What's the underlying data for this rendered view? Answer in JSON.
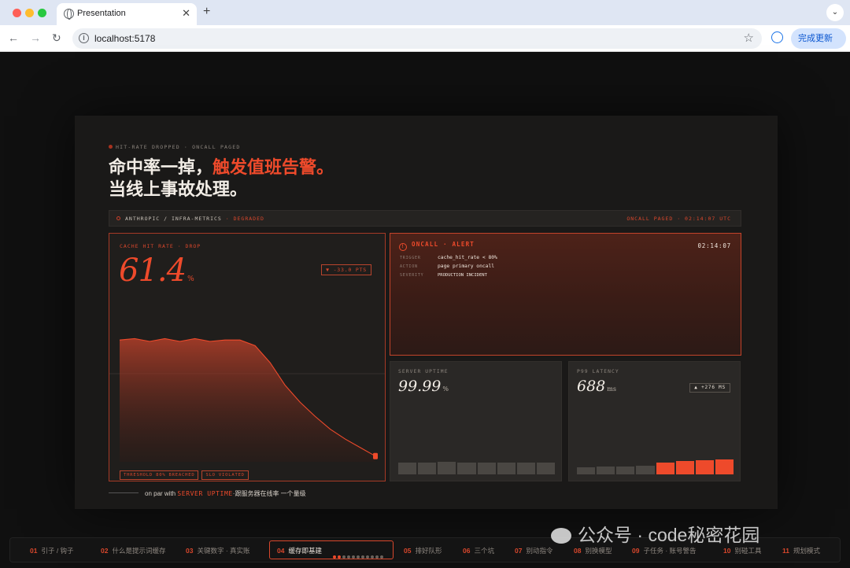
{
  "browser": {
    "tab_title": "Presentation",
    "url": "localhost:5178",
    "update_button": "完成更新"
  },
  "slide": {
    "eyebrow": "HIT-RATE DROPPED · ONCALL PAGED",
    "headline_line1_plain": "命中率一掉，",
    "headline_line1_accent": "触发值班告警。",
    "headline_line2": "当线上事故处理。",
    "system": {
      "path": "ANTHROPIC / INFRA-METRICS",
      "status": "· DEGRADED",
      "right": "ONCALL PAGED · 02:14:07 UTC"
    },
    "cache_card": {
      "label": "CACHE HIT RATE · DROP",
      "value": "61.4",
      "unit": "%",
      "delta": "▼ -33.0 PTS",
      "tags": [
        "THRESHOLD 80% BREACHED",
        "SLO VIOLATED"
      ]
    },
    "alert": {
      "title": "ONCALL · ALERT",
      "icon": "!",
      "time": "02:14:07",
      "rows": [
        {
          "key": "TRIGGER",
          "value": "cache_hit_rate < 80%"
        },
        {
          "key": "ACTION",
          "value": "page primary oncall"
        },
        {
          "key": "SEVERITY",
          "value": "PRODUCTION INCIDENT"
        }
      ]
    },
    "uptime": {
      "label": "SERVER UPTIME",
      "value": "99.99",
      "unit": "%"
    },
    "latency": {
      "label": "P99 LATENCY",
      "value": "688",
      "unit": "ms",
      "delta": "▲ +276 MS"
    },
    "footnote": {
      "prefix": "on par with ",
      "highlight": "SERVER UPTIME",
      "suffix": "·跟服务器在线率 一个量级"
    }
  },
  "nav": {
    "items": [
      {
        "num": "01",
        "label": "引子 / 钩子"
      },
      {
        "num": "02",
        "label": "什么是提示词缓存"
      },
      {
        "num": "03",
        "label": "关键数字 · 真实账"
      },
      {
        "num": "04",
        "label": "缓存即基建"
      },
      {
        "num": "05",
        "label": "排好队形"
      },
      {
        "num": "06",
        "label": "三个坑"
      },
      {
        "num": "07",
        "label": "别动指令"
      },
      {
        "num": "08",
        "label": "别换模型"
      },
      {
        "num": "09",
        "label": "子任务 · 账号警告"
      },
      {
        "num": "10",
        "label": "别碰工具"
      },
      {
        "num": "11",
        "label": "规划模式"
      }
    ],
    "active_index": 3
  },
  "watermark": "公众号 · code秘密花园",
  "chart_data": [
    {
      "type": "area",
      "title": "",
      "x": [
        0,
        1,
        2,
        3,
        4,
        5,
        6,
        7,
        8,
        9,
        10,
        11,
        12,
        13,
        14,
        15,
        16,
        17
      ],
      "values": [
        96,
        97,
        95,
        97,
        95,
        97,
        95,
        96,
        96,
        92,
        80,
        64,
        52,
        42,
        33,
        26,
        20,
        14
      ],
      "color": "#ee4a2b"
    },
    {
      "type": "bar",
      "title": "",
      "values": [
        0.62,
        0.62,
        0.66,
        0.64,
        0.64,
        0.62,
        0.64,
        0.62
      ],
      "color": "#4a4743"
    },
    {
      "type": "bar",
      "title": "",
      "values": [
        0.38,
        0.4,
        0.4,
        0.46,
        0.62,
        0.72,
        0.76,
        0.8
      ],
      "highlight_from": 4,
      "colors": [
        "#4a4743",
        "#ee4a2b"
      ]
    }
  ]
}
